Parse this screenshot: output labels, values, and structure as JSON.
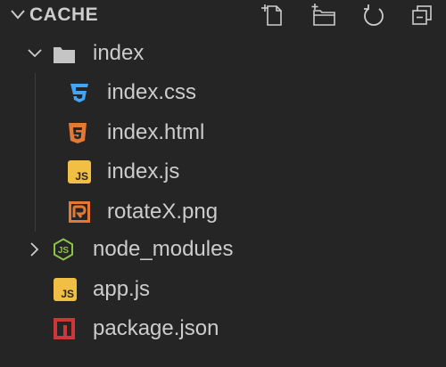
{
  "explorer": {
    "section_title": "CACHE",
    "toolbar": {
      "new_file_icon": "new-file-icon",
      "new_folder_icon": "new-folder-icon",
      "refresh_icon": "refresh-icon",
      "collapse_all_icon": "collapse-all-icon"
    },
    "tree": [
      {
        "label": "index",
        "type": "folder",
        "expanded": true,
        "icon": "folder-icon"
      },
      {
        "label": "index.css",
        "type": "file",
        "icon": "css-file-icon"
      },
      {
        "label": "index.html",
        "type": "file",
        "icon": "html-file-icon"
      },
      {
        "label": "index.js",
        "type": "file",
        "icon": "js-file-icon"
      },
      {
        "label": "rotateX.png",
        "type": "file",
        "icon": "image-file-icon"
      },
      {
        "label": "node_modules",
        "type": "folder",
        "expanded": false,
        "icon": "nodejs-folder-icon"
      },
      {
        "label": "app.js",
        "type": "file",
        "icon": "js-file-icon"
      },
      {
        "label": "package.json",
        "type": "file",
        "icon": "npm-package-icon"
      }
    ],
    "colors": {
      "background": "#252526",
      "text": "#cccccc",
      "css_icon": "#42a5f5",
      "html_icon": "#e37933",
      "js_icon": "#f1bf44",
      "image_icon": "#e37933",
      "nodejs_icon": "#8bc34a",
      "npm_icon": "#cb3837",
      "folder_icon": "#c5c5c5"
    }
  }
}
